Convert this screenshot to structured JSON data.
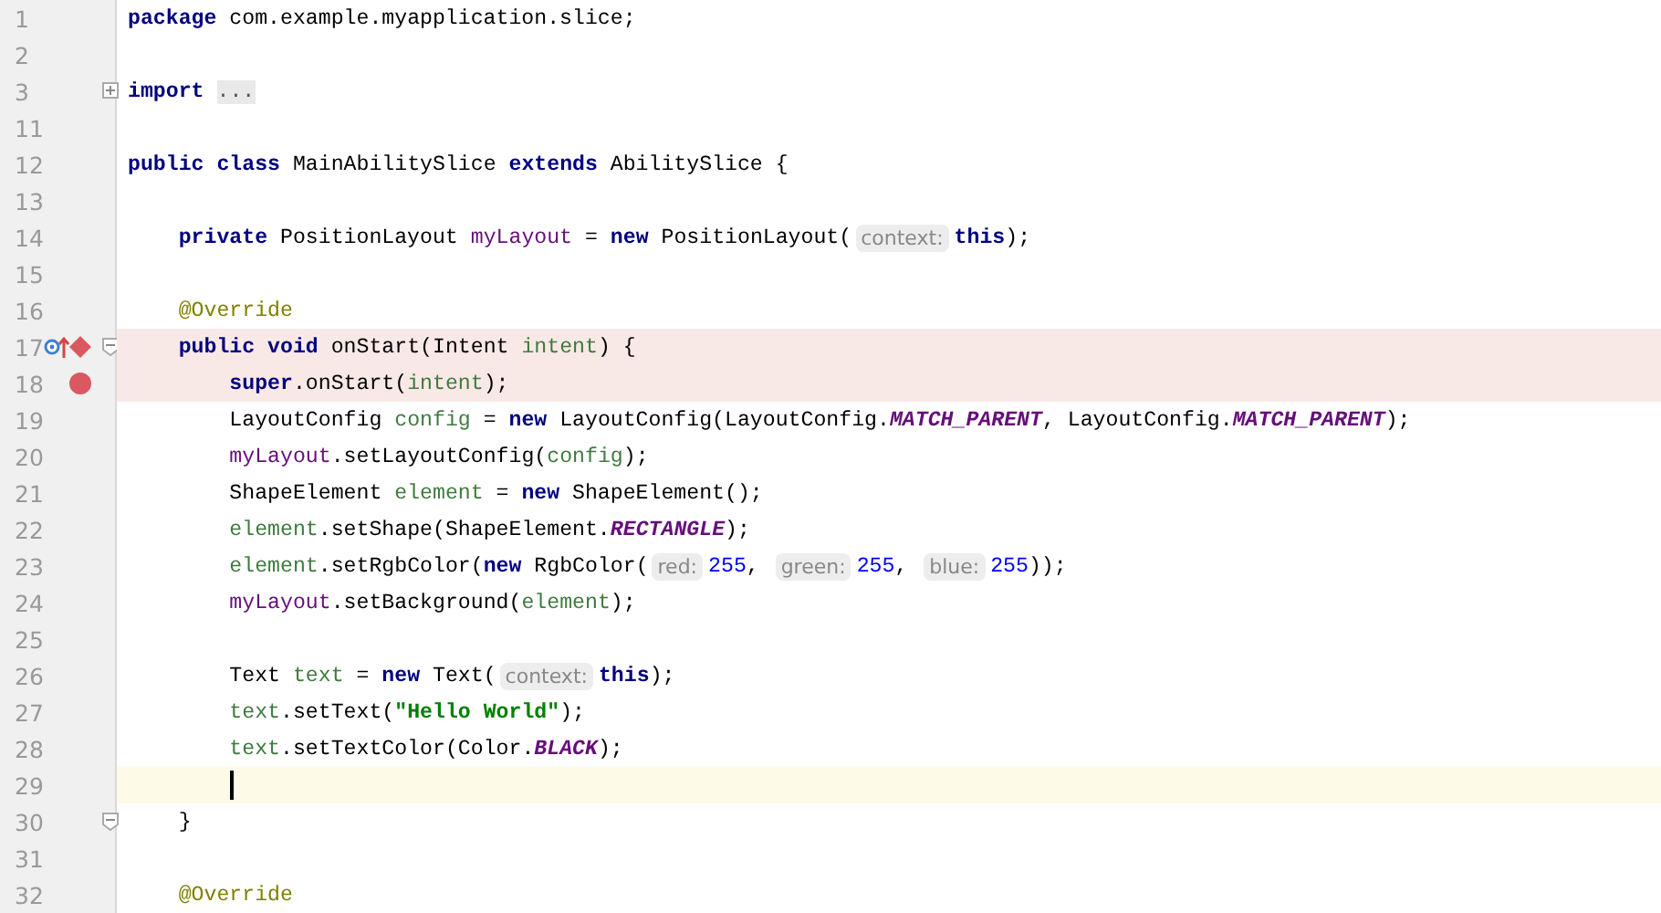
{
  "editor": {
    "lines": [
      {
        "number": "1",
        "tokens": [
          {
            "kind": "keyword",
            "text": "package"
          },
          {
            "kind": "plain",
            "text": " com.example.myapplication.slice;"
          }
        ]
      },
      {
        "number": "2"
      },
      {
        "number": "3",
        "folded": true,
        "tokens": [
          {
            "kind": "keyword",
            "text": "import"
          },
          {
            "kind": "folded",
            "text": "..."
          }
        ]
      },
      {
        "number": "11"
      },
      {
        "number": "12",
        "tokens": [
          {
            "kind": "keyword",
            "text": "public class"
          },
          {
            "kind": "plain",
            "text": " MainAbilitySlice "
          },
          {
            "kind": "keyword",
            "text": "extends"
          },
          {
            "kind": "plain",
            "text": " AbilitySlice {"
          }
        ]
      },
      {
        "number": "13"
      },
      {
        "number": "14",
        "tokens": [
          {
            "kind": "keyword",
            "text": "    private"
          },
          {
            "kind": "plain",
            "text": " PositionLayout "
          },
          {
            "kind": "field",
            "text": "myLayout"
          },
          {
            "kind": "plain",
            "text": " = "
          },
          {
            "kind": "keyword",
            "text": "new"
          },
          {
            "kind": "plain",
            "text": " PositionLayout("
          },
          {
            "kind": "hint",
            "text": "context:"
          },
          {
            "kind": "keyword",
            "text": "this"
          },
          {
            "kind": "plain",
            "text": ");"
          }
        ]
      },
      {
        "number": "15"
      },
      {
        "number": "16",
        "tokens": [
          {
            "kind": "annotation",
            "text": "    @Override"
          }
        ]
      },
      {
        "number": "17",
        "breakpoint": true,
        "method_breakpoint": true,
        "override_marker": true,
        "folded": false,
        "tokens": [
          {
            "kind": "keyword",
            "text": "    public void"
          },
          {
            "kind": "plain",
            "text": " onStart(Intent "
          },
          {
            "kind": "local",
            "text": "intent"
          },
          {
            "kind": "plain",
            "text": ") {"
          }
        ]
      },
      {
        "number": "18",
        "breakpoint": true,
        "tokens": [
          {
            "kind": "keyword",
            "text": "        super"
          },
          {
            "kind": "plain",
            "text": ".onStart("
          },
          {
            "kind": "local",
            "text": "intent"
          },
          {
            "kind": "plain",
            "text": ");"
          }
        ]
      },
      {
        "number": "19",
        "tokens": [
          {
            "kind": "plain",
            "text": "        LayoutConfig "
          },
          {
            "kind": "local",
            "text": "config"
          },
          {
            "kind": "plain",
            "text": " = "
          },
          {
            "kind": "keyword",
            "text": "new"
          },
          {
            "kind": "plain",
            "text": " LayoutConfig(LayoutConfig."
          },
          {
            "kind": "constant",
            "text": "MATCH_PARENT"
          },
          {
            "kind": "plain",
            "text": ", LayoutConfig."
          },
          {
            "kind": "constant",
            "text": "MATCH_PARENT"
          },
          {
            "kind": "plain",
            "text": ");"
          }
        ]
      },
      {
        "number": "20",
        "tokens": [
          {
            "kind": "field",
            "text": "        myLayout"
          },
          {
            "kind": "plain",
            "text": ".setLayoutConfig("
          },
          {
            "kind": "local",
            "text": "config"
          },
          {
            "kind": "plain",
            "text": ");"
          }
        ]
      },
      {
        "number": "21",
        "tokens": [
          {
            "kind": "plain",
            "text": "        ShapeElement "
          },
          {
            "kind": "local",
            "text": "element"
          },
          {
            "kind": "plain",
            "text": " = "
          },
          {
            "kind": "keyword",
            "text": "new"
          },
          {
            "kind": "plain",
            "text": " ShapeElement();"
          }
        ]
      },
      {
        "number": "22",
        "tokens": [
          {
            "kind": "local",
            "text": "        element"
          },
          {
            "kind": "plain",
            "text": ".setShape(ShapeElement."
          },
          {
            "kind": "constant",
            "text": "RECTANGLE"
          },
          {
            "kind": "plain",
            "text": ");"
          }
        ]
      },
      {
        "number": "23",
        "tokens": [
          {
            "kind": "local",
            "text": "        element"
          },
          {
            "kind": "plain",
            "text": ".setRgbColor("
          },
          {
            "kind": "keyword",
            "text": "new"
          },
          {
            "kind": "plain",
            "text": " RgbColor("
          },
          {
            "kind": "hint",
            "text": "red:"
          },
          {
            "kind": "number",
            "text": "255"
          },
          {
            "kind": "plain",
            "text": ", "
          },
          {
            "kind": "hint",
            "text": "green:"
          },
          {
            "kind": "number",
            "text": "255"
          },
          {
            "kind": "plain",
            "text": ", "
          },
          {
            "kind": "hint",
            "text": "blue:"
          },
          {
            "kind": "number",
            "text": "255"
          },
          {
            "kind": "plain",
            "text": "));"
          }
        ]
      },
      {
        "number": "24",
        "tokens": [
          {
            "kind": "field",
            "text": "        myLayout"
          },
          {
            "kind": "plain",
            "text": ".setBackground("
          },
          {
            "kind": "local",
            "text": "element"
          },
          {
            "kind": "plain",
            "text": ");"
          }
        ]
      },
      {
        "number": "25"
      },
      {
        "number": "26",
        "tokens": [
          {
            "kind": "plain",
            "text": "        Text "
          },
          {
            "kind": "local",
            "text": "text"
          },
          {
            "kind": "plain",
            "text": " = "
          },
          {
            "kind": "keyword",
            "text": "new"
          },
          {
            "kind": "plain",
            "text": " Text("
          },
          {
            "kind": "hint",
            "text": "context:"
          },
          {
            "kind": "keyword",
            "text": "this"
          },
          {
            "kind": "plain",
            "text": ");"
          }
        ]
      },
      {
        "number": "27",
        "tokens": [
          {
            "kind": "local",
            "text": "        text"
          },
          {
            "kind": "plain",
            "text": ".setText("
          },
          {
            "kind": "string",
            "text": "\"Hello World\""
          },
          {
            "kind": "plain",
            "text": ");"
          }
        ]
      },
      {
        "number": "28",
        "tokens": [
          {
            "kind": "local",
            "text": "        text"
          },
          {
            "kind": "plain",
            "text": ".setTextColor(Color."
          },
          {
            "kind": "constant",
            "text": "BLACK"
          },
          {
            "kind": "plain",
            "text": ");"
          }
        ]
      },
      {
        "number": "29",
        "current_line": true
      },
      {
        "number": "30",
        "folded": false,
        "tokens": [
          {
            "kind": "plain",
            "text": "    }"
          }
        ]
      },
      {
        "number": "31"
      },
      {
        "number": "32",
        "tokens": [
          {
            "kind": "annotation",
            "text": "    @Override"
          }
        ]
      }
    ]
  }
}
